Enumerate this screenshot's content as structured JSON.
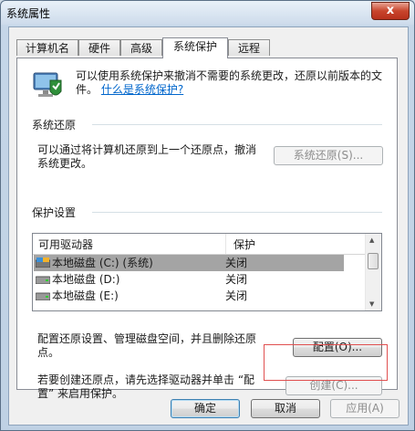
{
  "window": {
    "title": "系统属性",
    "close_label": "x"
  },
  "tabs": [
    {
      "label": "计算机名",
      "active": false
    },
    {
      "label": "硬件",
      "active": false
    },
    {
      "label": "高级",
      "active": false
    },
    {
      "label": "系统保护",
      "active": true
    },
    {
      "label": "远程",
      "active": false
    }
  ],
  "intro": {
    "text": "可以使用系统保护来撤消不需要的系统更改，还原以前版本的文件。",
    "link": "什么是系统保护?"
  },
  "restore": {
    "group_label": "系统还原",
    "description": "可以通过将计算机还原到上一个还原点，撤消系统更改。",
    "button": "系统还原(S)..."
  },
  "protection": {
    "group_label": "保护设置",
    "columns": [
      "可用驱动器",
      "保护"
    ],
    "drives": [
      {
        "name": "本地磁盘 (C:) (系统)",
        "protection": "关闭",
        "selected": true,
        "icon": "system-drive-icon"
      },
      {
        "name": "本地磁盘 (D:)",
        "protection": "关闭",
        "selected": false,
        "icon": "drive-icon"
      },
      {
        "name": "本地磁盘 (E:)",
        "protection": "关闭",
        "selected": false,
        "icon": "drive-icon"
      }
    ],
    "configure_text": "配置还原设置、管理磁盘空间，并且删除还原点。",
    "configure_button": "配置(O)...",
    "create_text": "若要创建还原点，请先选择驱动器并单击 “配置” 来启用保护。",
    "create_button": "创建(C)..."
  },
  "footer": {
    "ok": "确定",
    "cancel": "取消",
    "apply": "应用(A)"
  },
  "colors": {
    "highlight_box": "#e05050",
    "link": "#0066cc",
    "selected_row": "#a4a4a4"
  }
}
